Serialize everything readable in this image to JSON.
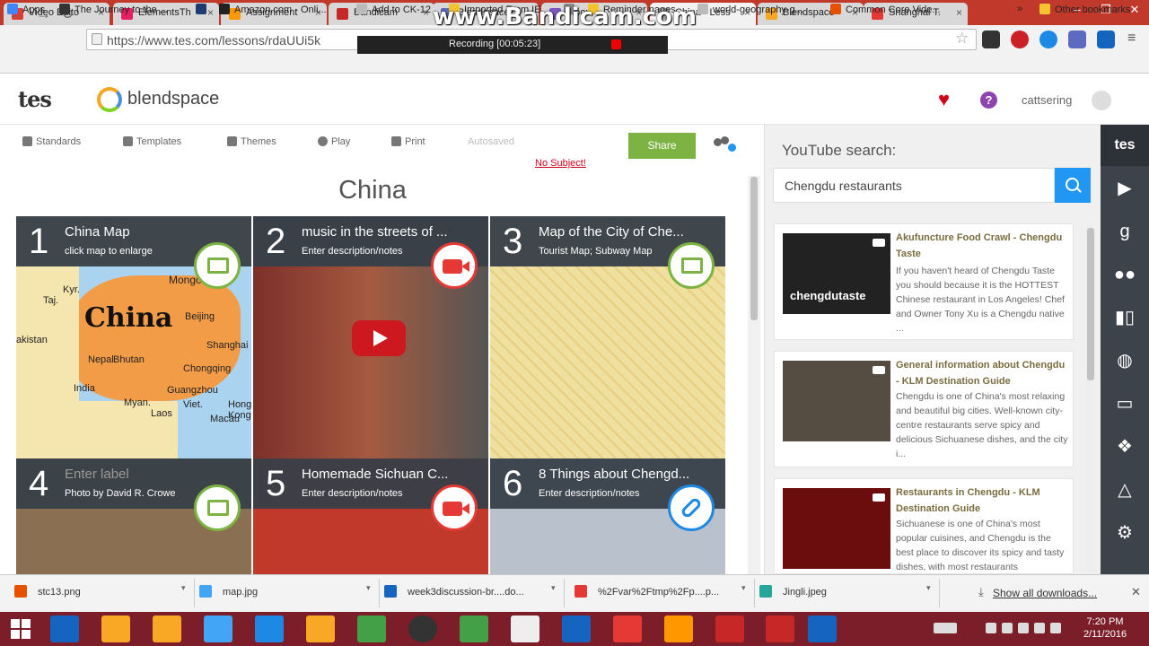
{
  "browser": {
    "tabs": [
      {
        "label": "Video Edito",
        "color": "#e53935"
      },
      {
        "label": "ElementsTh",
        "color": "#e91e63"
      },
      {
        "label": "Assignment",
        "color": "#ff9800"
      },
      {
        "label": "Bandicam",
        "color": "#c62828"
      },
      {
        "label": "Blendspace",
        "color": "#5c6bc0"
      },
      {
        "label": "Inbox",
        "color": "#7e57c2"
      },
      {
        "label": "China - Less",
        "color": "#9e9e9e"
      },
      {
        "label": "Blendspace",
        "color": "#f5a623"
      },
      {
        "label": "Shanghai T.",
        "color": "#e53935"
      }
    ],
    "window_buttons": [
      "–",
      "❐",
      "✕"
    ],
    "url": "https://www.tes.com/lessons/rdaUUi5k",
    "bookmarks": [
      {
        "label": "Apps",
        "color": "#4285f4"
      },
      {
        "label": "The Journey to the ...",
        "color": "#333333"
      },
      {
        "label": "",
        "color": "#1e3c72"
      },
      {
        "label": "Amazon.com - Onli...",
        "color": "#222222"
      },
      {
        "label": "Add to CK-12",
        "color": "#bbbbbb"
      },
      {
        "label": "Imported From IE",
        "color": "#f4c430"
      },
      {
        "label": "",
        "color": "#888888"
      },
      {
        "label": "Reminder pages",
        "color": "#f4c430"
      },
      {
        "label": "world-geography-g...",
        "color": "#bbbbbb"
      },
      {
        "label": "Common Core Vide...",
        "color": "#e65100"
      },
      {
        "label": "»",
        "color": ""
      },
      {
        "label": "Other bookmarks",
        "color": "#f4c430"
      }
    ]
  },
  "recorder": {
    "watermark": "www.Bandicam.com",
    "status": "Recording [00:05:23]"
  },
  "app": {
    "logo": "tes",
    "product": "blendspace",
    "username": "cattsering",
    "heart_icon": "heart-icon",
    "help": "?"
  },
  "editor": {
    "tools": [
      "Standards",
      "Templates",
      "Themes",
      "Play",
      "Print"
    ],
    "autosaved": "Autosaved",
    "share": "Share",
    "no_subject": "No Subject!",
    "lesson_title": "China"
  },
  "tiles": [
    {
      "num": "1",
      "title": "China Map",
      "desc": "click map to enlarge",
      "type": "image",
      "bg": "#e8d7a2"
    },
    {
      "num": "2",
      "title": "music in the streets of ...",
      "desc": "Enter description/notes",
      "type": "video",
      "bg": "#6b5a4a"
    },
    {
      "num": "3",
      "title": "Map of the City of Che...",
      "desc": "Tourist Map; Subway Map",
      "type": "image",
      "bg": "#e9d894"
    },
    {
      "num": "4",
      "title": "Enter label",
      "desc": "Photo by David R. Crowe",
      "type": "image",
      "bg": "#8a6f52"
    },
    {
      "num": "5",
      "title": "Homemade Sichuan C...",
      "desc": "Enter description/notes",
      "type": "video",
      "bg": "#c0392b"
    },
    {
      "num": "6",
      "title": "8 Things about Chengd...",
      "desc": "Enter description/notes",
      "type": "link",
      "bg": "#b9c2cc"
    }
  ],
  "map_labels": {
    "country": "China",
    "places": [
      "Mongolia",
      "Kyr.",
      "Taj.",
      "Beijing",
      "Shanghai",
      "Chongqing",
      "Guangzhou",
      "Nepal",
      "Bhutan",
      "India",
      "Myan.",
      "Laos",
      "Viet.",
      "Hong Kong",
      "Macau",
      "akistan"
    ]
  },
  "youtube": {
    "label": "YouTube search:",
    "query": "Chengdu restaurants",
    "results": [
      {
        "title": "Akufuncture Food Crawl - Chengdu Taste",
        "desc": "If you haven't heard of Chengdu Taste you should because it is the HOTTEST Chinese restaurant in Los Angeles! Chef and Owner Tony Xu is a Chengdu native ...",
        "thumb_text": "chengdutaste"
      },
      {
        "title": "General information about Chengdu - KLM Destination Guide",
        "desc": "Chengdu is one of China's most relaxing and beautiful big cities. Well-known city-centre restaurants serve spicy and delicious Sichuanese dishes, and the city i...",
        "thumb_text": ""
      },
      {
        "title": "Restaurants in Chengdu - KLM Destination Guide",
        "desc": "Sichuanese is one of China's most popular cuisines, and Chengdu is the best place to discover its spicy and tasty dishes, with most restaurants",
        "thumb_text": ""
      }
    ]
  },
  "rail_icons": [
    "tes",
    "You Tube",
    "g",
    "flickr",
    "panel",
    "web",
    "screen",
    "dropbox",
    "drive",
    "settings"
  ],
  "downloads": [
    {
      "name": "stc13.png",
      "color": "#e65100"
    },
    {
      "name": "map.jpg",
      "color": "#42a5f5"
    },
    {
      "name": "week3discussion-br....do...",
      "color": "#1565c0"
    },
    {
      "name": "%2Fvar%2Ftmp%2Fp....p...",
      "color": "#e53935"
    },
    {
      "name": "Jingli.jpeg",
      "color": "#26a69a"
    }
  ],
  "show_all": "Show all downloads...",
  "taskbar": {
    "time": "7:20 PM",
    "date": "2/11/2016",
    "apps": [
      "#1565c0",
      "#f9a825",
      "#f9a825",
      "#42a5f5",
      "#1e88e5",
      "#f9a825",
      "#43a047",
      "#333333",
      "#43a047",
      "#eeeeee",
      "#1565c0",
      "#e53935",
      "#ff9800",
      "#c62828",
      "#c62828",
      "#1565c0"
    ]
  }
}
